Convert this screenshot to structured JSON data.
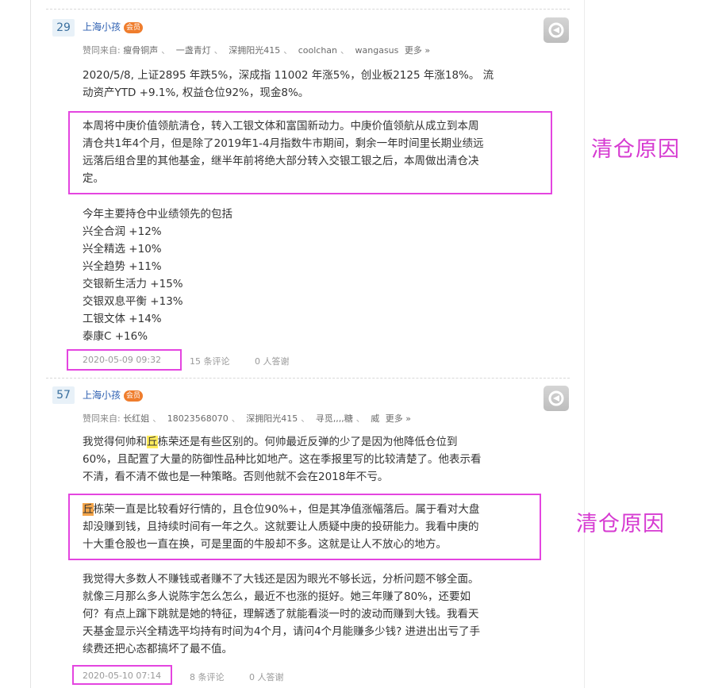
{
  "posts": [
    {
      "floor": "29",
      "author": "上海小孩",
      "vip": "会员",
      "likes_prefix": "赞同来自:",
      "likers": [
        "瘦骨铜声",
        "一盏青灯",
        "深拥阳光415",
        "coolchan",
        "wangasus"
      ],
      "more": "更多 »",
      "para1_line1": "2020/5/8, 上证2895 年跌5%，深成指 11002 年涨5%，创业板2125 年涨18%。 流",
      "para1_line2": "动资产YTD +9.1%, 权益仓位92%，现金8%。",
      "boxed": [
        "本周将中庚价值领航清仓，转入工银文体和富国新动力。中庚价值领航从成立到本周",
        "清仓共1年4个月，但是除了2019年1-4月指数牛市期间，剩余一年时间里长期业绩远",
        "远落后组合里的其他基金，继半年前将绝大部分转入交银工银之后，本周做出清仓决",
        "定。"
      ],
      "holdings_title": "今年主要持仓中业绩领先的包括",
      "holdings": [
        "兴全合润 +12%",
        "兴全精选 +10%",
        "兴全趋势 +11%",
        "交银新生活力 +15%",
        "交银双息平衡 +13%",
        "工银文体 +14%",
        "泰康C +16%"
      ],
      "date": "2020-05-09 09:32",
      "comments": "15 条评论",
      "agree": "0 人答谢"
    },
    {
      "floor": "57",
      "author": "上海小孩",
      "vip": "会员",
      "likes_prefix": "赞同来自:",
      "likers": [
        "长红姐",
        "18023568070",
        "深拥阳光415",
        "寻觅,,,,糖",
        "威"
      ],
      "more": "更多 »",
      "p1_a": "我觉得何帅和",
      "p1_hl": "丘",
      "p1_b": "栋荣还是有些区别的。何帅最近反弹的少了是因为他降低仓位到",
      "p1_line2": "60%，且配置了大量的防御性品种比如地产。这在季报里写的比较清楚了。他表示看",
      "p1_line3": "不清，看不清不做也是一种策略。否则他就不会在2018年不亏。",
      "b_hl": "丘",
      "b_line1": "栋荣一直是比较看好行情的，且仓位90%+，但是其净值涨幅落后。属于看对大盘",
      "b_line2": "却没赚到钱，且持续时间有一年之久。这就要让人质疑中庚的投研能力。我看中庚的",
      "b_line3": "十大重仓股也一直在换，可是里面的牛股却不多。这就是让人不放心的地方。",
      "p3": [
        "我觉得大多数人不赚钱或者赚不了大钱还是因为眼光不够长远，分析问题不够全面。",
        "就像三月那么多人说陈宇怎么怎么，最近不也涨的挺好。她三年赚了80%，还要如",
        "何？有点上蹿下跳就是她的特征，理解透了就能看淡一时的波动而赚到大钱。我看天",
        "天基金显示兴全精选平均持有时间为4个月，请问4个月能赚多少钱? 进进出出亏了手",
        "续费还把心态都搞坏了最不值。"
      ],
      "date": "2020-05-10 07:14",
      "comments": "8 条评论",
      "agree": "0 人答谢"
    }
  ],
  "annotations": [
    "清仓原因",
    "清仓原因"
  ],
  "colors": {
    "highlight_box": "#e445e0",
    "annotation": "#d63ad1",
    "link": "#2a5db0"
  },
  "icons": [
    "avatar-placeholder-icon"
  ]
}
